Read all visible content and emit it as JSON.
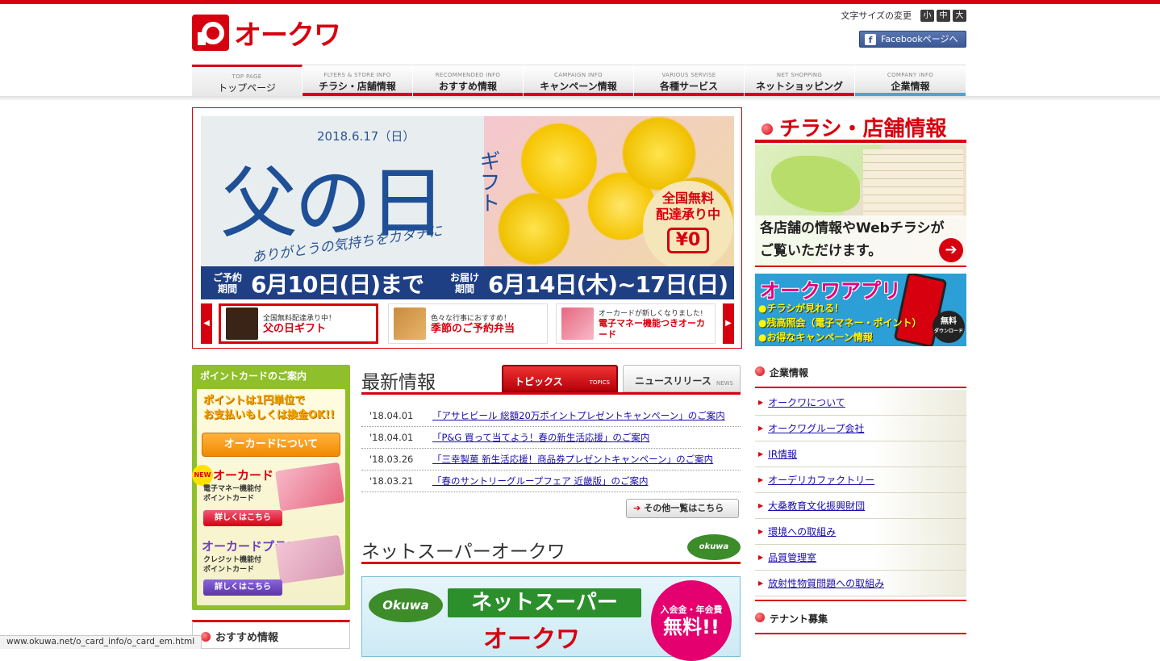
{
  "header": {
    "logo_text": "オークワ",
    "font_size_label": "文字サイズの変更",
    "font_sizes": [
      "小",
      "中",
      "大"
    ],
    "facebook_label": "Facebookページへ"
  },
  "nav": [
    {
      "en": "TOP PAGE",
      "jp": "トップページ"
    },
    {
      "en": "FLYERS & STORE INFO",
      "jp": "チラシ・店舗情報"
    },
    {
      "en": "RECOMMENDED INFO",
      "jp": "おすすめ情報"
    },
    {
      "en": "CAMPAIGN INFO",
      "jp": "キャンペーン情報"
    },
    {
      "en": "VARIOUS SERVISE",
      "jp": "各種サービス"
    },
    {
      "en": "NET SHOPPING",
      "jp": "ネットショッピング"
    },
    {
      "en": "COMPANY INFO",
      "jp": "企業情報"
    }
  ],
  "hero": {
    "date": "2018.6.17（日）",
    "title": "父の日",
    "gift": "ギフト",
    "thanks": "ありがとうの気持ちをカタチに",
    "free_line1": "全国無料",
    "free_line2": "配達承り中",
    "free_yen": "¥0",
    "order_key": "ご予約期間",
    "order_date": "6月10日(日)まで",
    "deliver_key": "お届け期間",
    "deliver_date": "6月14日(木)~17日(日)"
  },
  "carousel": [
    {
      "sub": "全国無料配達承り中！",
      "main": "父の日ギフト"
    },
    {
      "sub": "色々な行事におすすめ！",
      "main": "季節のご予約弁当"
    },
    {
      "sub": "オーカードが新しくなりました!",
      "main": "電子マネー機能つきオーカード"
    }
  ],
  "point_card": {
    "heading": "ポイントカードのご案内",
    "catch1": "ポイントは1円単位で",
    "catch2": "お支払いもしくは換金OK!!",
    "about_button": "オーカードについて",
    "new_badge": "NEW",
    "card1_name": "オーカード",
    "card1_desc1": "電子マネー機能付",
    "card1_desc2": "ポイントカード",
    "card1_button": "詳しくはこちら",
    "card2_name": "オーカードプラス",
    "card2_desc1": "クレジット機能付",
    "card2_desc2": "ポイントカード",
    "card2_button": "詳しくはこちら"
  },
  "osusume_heading": "おすすめ情報",
  "news": {
    "heading": "最新情報",
    "tab_topics": "トピックス",
    "tab_topics_en": "TOPICS",
    "tab_release": "ニュースリリース",
    "tab_release_en": "NEWS",
    "items": [
      {
        "date": "'18.04.01",
        "text": "「アサヒビール 総額20万ポイントプレゼントキャンペーン」のご案内"
      },
      {
        "date": "'18.04.01",
        "text": "「P&G 買って当てよう！春の新生活応援」のご案内"
      },
      {
        "date": "'18.03.26",
        "text": "「三幸製菓 新生活応援！商品券プレゼントキャンペーン」のご案内"
      },
      {
        "date": "'18.03.21",
        "text": "「春のサントリーグループフェア 近畿版」のご案内"
      }
    ],
    "more": "その他一覧はこちら"
  },
  "net_super": {
    "heading": "ネットスーパーオークワ",
    "logo": "okuwa",
    "banner_logo": "Okuwa",
    "banner_line1": "ネットスーパー",
    "banner_line2": "オークワ",
    "fee_label": "入会金・年会費",
    "fee_value": "無料!!"
  },
  "right": {
    "flyer_heading": "チラシ・店舗情報",
    "flyer_text1": "各店舗の情報やWebチラシが",
    "flyer_text2": "ご覧いただけます。",
    "app_title": "オークワアプリ",
    "app_points": [
      "●チラシが見れる！",
      "●残高照会（電子マネー・ポイント）",
      "●お得なキャンペーン情報"
    ],
    "app_download1": "無料",
    "app_download2": "ダウンロード",
    "company_heading": "企業情報",
    "company_links": [
      "オークワについて",
      "オークワグループ会社",
      "IR情報",
      "オーデリカファクトリー",
      "大桑教育文化振興財団",
      "環境への取組み",
      "品質管理室",
      "放射性物質問題への取組み"
    ],
    "tenant_heading": "テナント募集"
  },
  "status_url": "www.okuwa.net/o_card_info/o_card_em.html"
}
